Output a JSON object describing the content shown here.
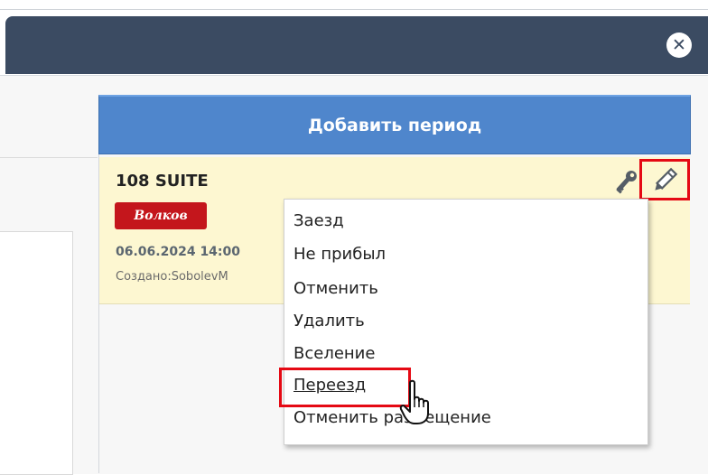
{
  "header": {
    "close_label": "✕"
  },
  "actions": {
    "add_period_label": "Добавить период"
  },
  "booking": {
    "room": "108 SUITE",
    "guest": "Волков",
    "dates": "06.06.2024 14:00",
    "created_by": "Создано:SobolevM"
  },
  "context_menu": {
    "items": [
      {
        "label": "Заезд"
      },
      {
        "label": "Не прибыл"
      },
      {
        "label": "Отменить"
      },
      {
        "label": "Удалить"
      },
      {
        "label": "Вселение"
      },
      {
        "label": "Переезд"
      },
      {
        "label": "Отменить размещение"
      }
    ],
    "hovered_item": "Переезд"
  },
  "colors": {
    "header_bg": "#3b4b62",
    "add_period_bg": "#4f86cc",
    "card_bg": "#fdf7d1",
    "guest_badge_bg": "#c4161c",
    "highlight_red": "#e50914"
  },
  "icons": {
    "close": "close-icon",
    "key": "key-icon",
    "edit": "pencil-icon",
    "cursor": "hand-pointer-icon"
  }
}
